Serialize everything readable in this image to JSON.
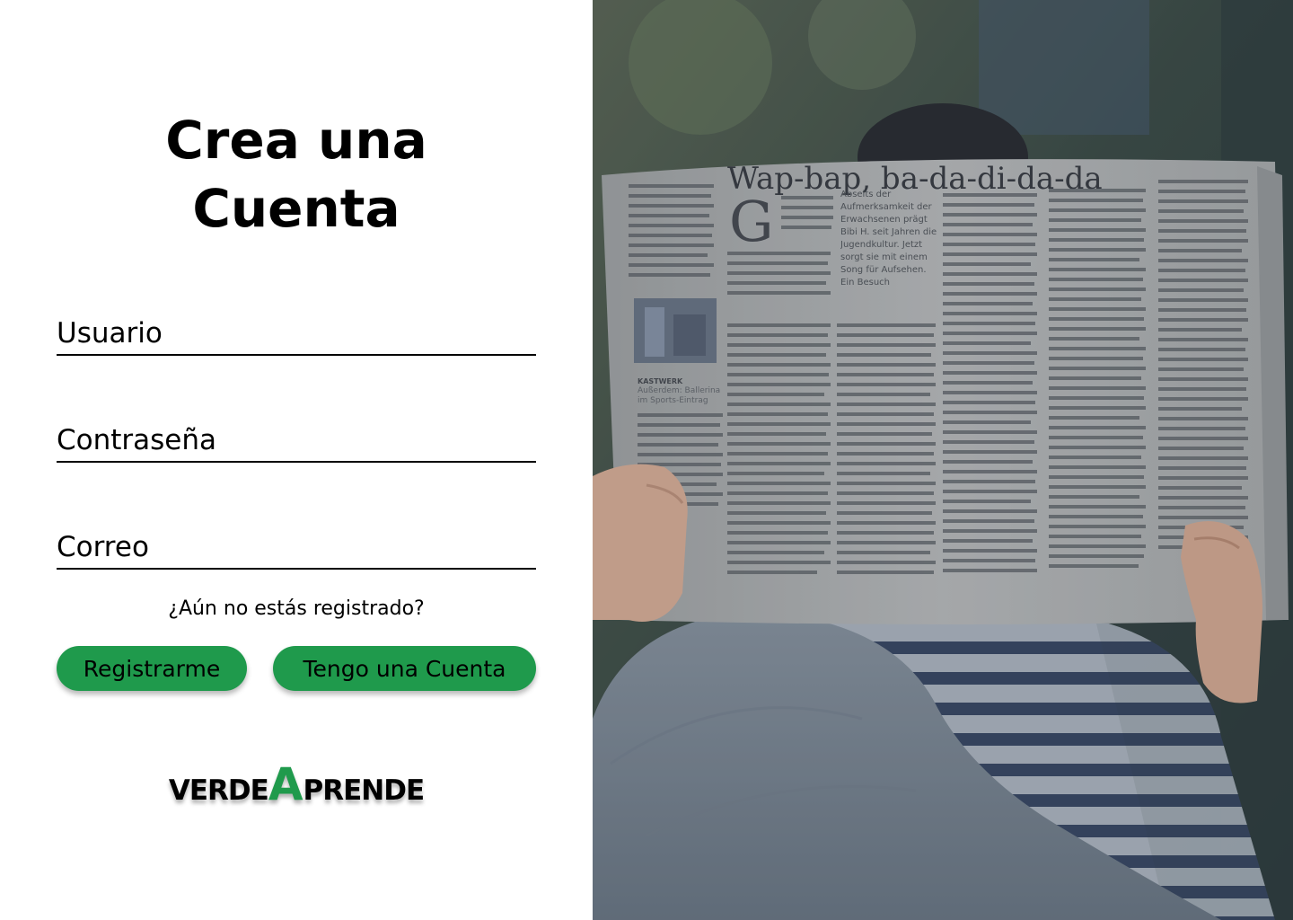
{
  "form": {
    "title_line1": "Crea una",
    "title_line2": "Cuenta",
    "fields": [
      {
        "name": "usuario",
        "placeholder": "Usuario",
        "value": ""
      },
      {
        "name": "contrasena",
        "placeholder": "Contraseña",
        "value": ""
      },
      {
        "name": "correo",
        "placeholder": "Correo",
        "value": ""
      }
    ],
    "question": "¿Aún no estás registrado?",
    "register_label": "Registrarme",
    "login_label": "Tengo una Cuenta"
  },
  "logo": {
    "part1": "VERDE",
    "part2": "A",
    "part3": "PRENDE"
  },
  "hero": {
    "newspaper_headline": "Wap-bap, ba-da-di-da-da",
    "dropcap": "G",
    "pull_quote": "Abseits der Aufmerksamkeit der Erwachsenen prägt Bibi H. seit Jahren die Jugendkultur. Jetzt sorgt sie mit einem Song für Aufsehen. Ein Besuch",
    "side_heading": "KASTWERK",
    "side_subheading": "Außerdem: Ballerina im Sports-Eintrag"
  },
  "colors": {
    "brand_green": "#1f9a4c",
    "text": "#000000"
  }
}
